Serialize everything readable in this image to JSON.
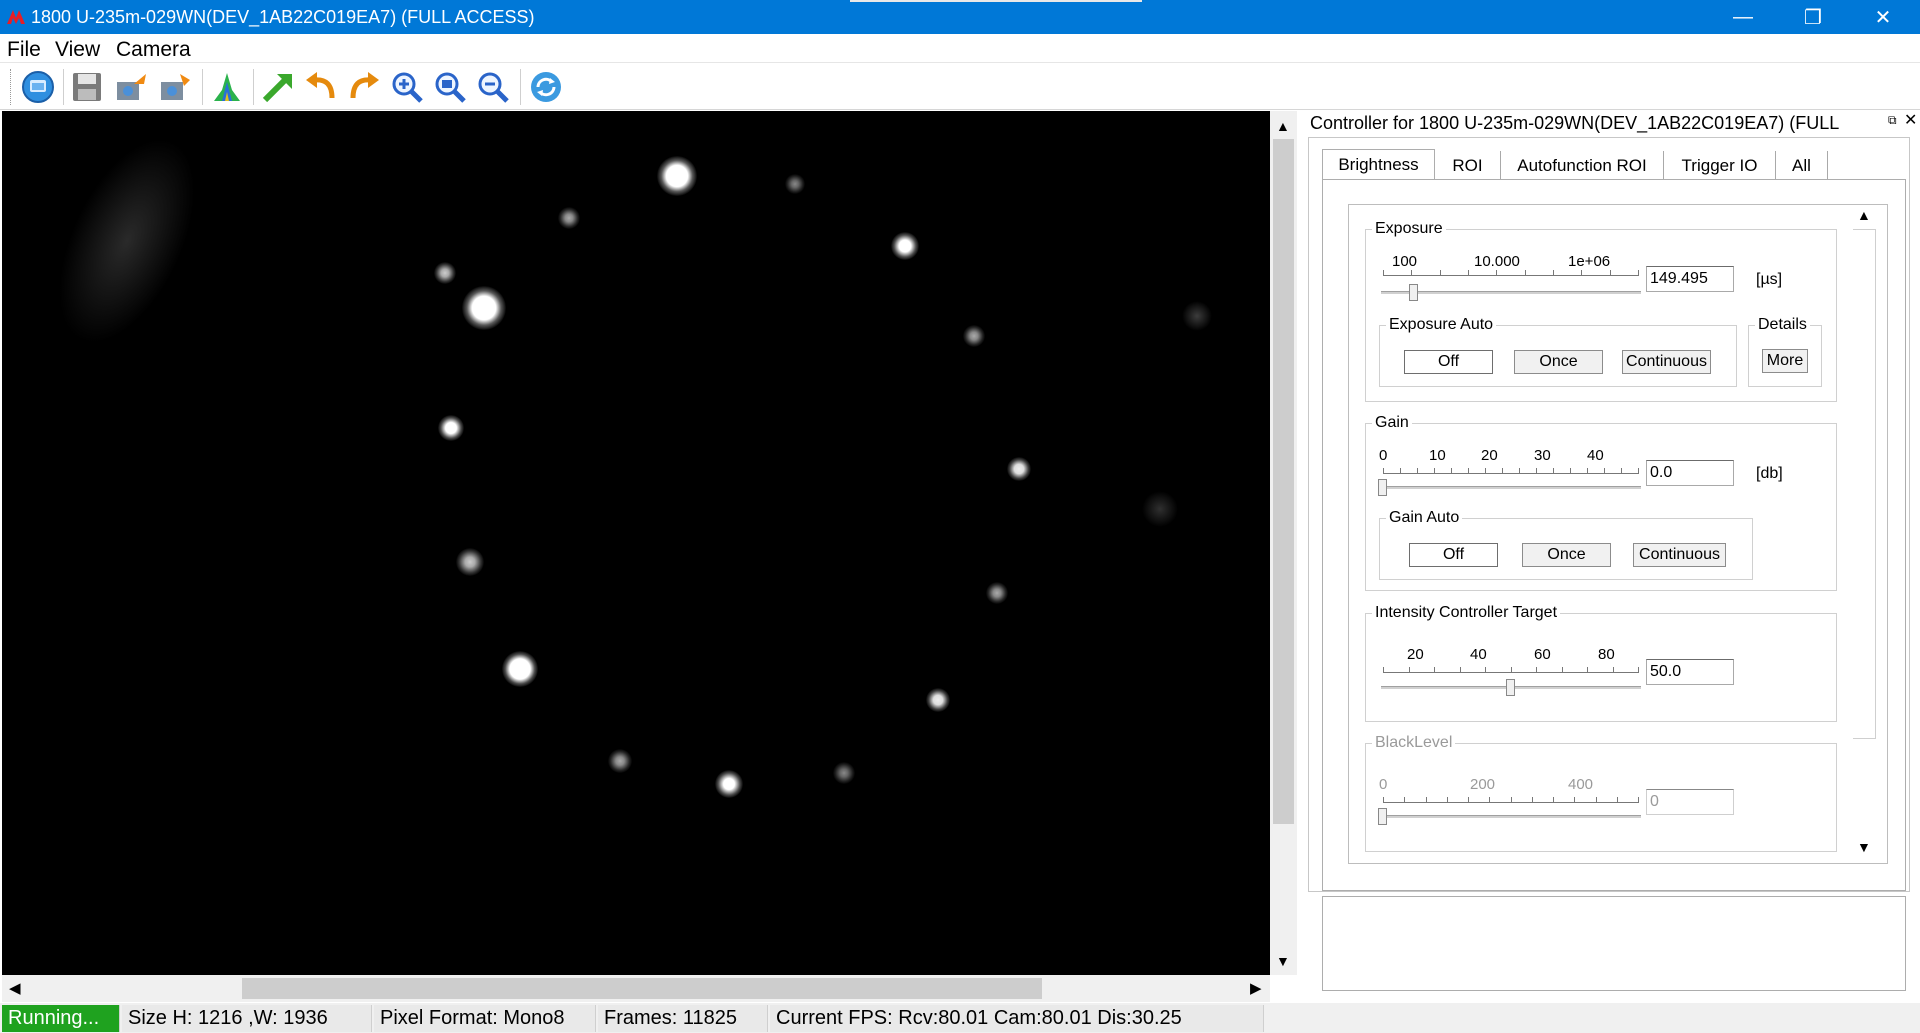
{
  "window": {
    "title": "1800 U-235m-029WN(DEV_1AB22C019EA7) (FULL ACCESS)",
    "minimize_glyph": "—",
    "maximize_glyph": "❐",
    "close_glyph": "✕"
  },
  "menu": [
    "File",
    "View",
    "Camera"
  ],
  "toolbar": {
    "icons": [
      "open-camera-icon",
      "save-icon",
      "import-settings-icon",
      "export-settings-icon",
      "histogram-icon",
      "fit-window-icon",
      "undo-icon",
      "redo-icon",
      "zoom-in-icon",
      "zoom-fit-icon",
      "zoom-out-icon",
      "refresh-icon"
    ]
  },
  "viewer": {
    "scroll_up": "▲",
    "scroll_down": "▼",
    "scroll_left": "◀",
    "scroll_right": "▶"
  },
  "controller": {
    "title": "Controller for 1800 U-235m-029WN(DEV_1AB22C019EA7) (FULL",
    "float_glyph": "⧉",
    "close_glyph": "✕",
    "tabs": [
      {
        "label": "Brightness",
        "active": true
      },
      {
        "label": "ROI",
        "active": false
      },
      {
        "label": "Autofunction ROI",
        "active": false
      },
      {
        "label": "Trigger IO",
        "active": false
      },
      {
        "label": "All",
        "active": false
      }
    ],
    "scroll_up": "▲",
    "scroll_down": "▼",
    "exposure": {
      "legend": "Exposure",
      "ticks": [
        "100",
        "10.000",
        "1e+06"
      ],
      "value": "149.495",
      "unit": "[µs]",
      "slider_fraction": 0.12,
      "auto_legend": "Exposure Auto",
      "auto_buttons": [
        "Off",
        "Once",
        "Continuous"
      ],
      "auto_selected": "Off",
      "details_legend": "Details",
      "details_button": "More"
    },
    "gain": {
      "legend": "Gain",
      "ticks": [
        "0",
        "10",
        "20",
        "30",
        "40"
      ],
      "value": "0.0",
      "unit": "[db]",
      "slider_fraction": 0.0,
      "auto_legend": "Gain Auto",
      "auto_buttons": [
        "Off",
        "Once",
        "Continuous"
      ],
      "auto_selected": "Off"
    },
    "intensity": {
      "legend": "Intensity Controller Target",
      "ticks": [
        "20",
        "40",
        "60",
        "80"
      ],
      "value": "50.0",
      "slider_fraction": 0.5
    },
    "blacklevel": {
      "legend": "BlackLevel",
      "ticks": [
        "0",
        "200",
        "400"
      ],
      "value": "0",
      "slider_fraction": 0.0
    }
  },
  "status": {
    "running": "Running...",
    "size": "Size H: 1216 ,W: 1936",
    "pixel_format": "Pixel Format: Mono8",
    "frames": "Frames: 11825",
    "fps": "Current FPS: Rcv:80.01 Cam:80.01 Dis:30.25"
  }
}
